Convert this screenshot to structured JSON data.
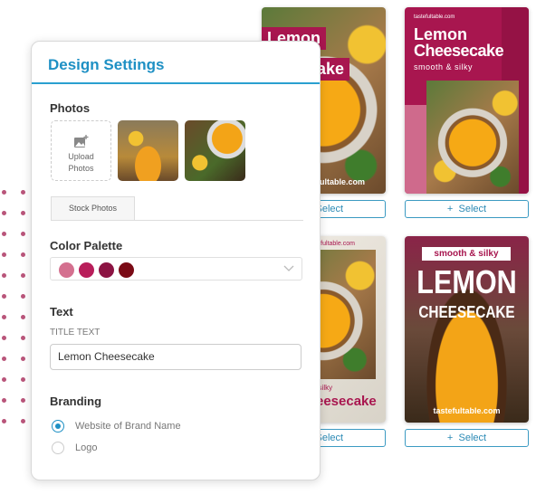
{
  "panel": {
    "title": "Design Settings",
    "photos": {
      "heading": "Photos",
      "upload_label_1": "Upload",
      "upload_label_2": "Photos",
      "tab": "Stock Photos"
    },
    "palette": {
      "heading": "Color Palette",
      "colors": [
        "#d4708f",
        "#b81e5a",
        "#8c1443",
        "#7a0a15"
      ]
    },
    "text": {
      "heading": "Text",
      "field_label": "TITLE TEXT",
      "title_value": "Lemon Cheesecake"
    },
    "branding": {
      "heading": "Branding",
      "options": [
        {
          "label": "Website of Brand Name",
          "selected": true
        },
        {
          "label": "Logo",
          "selected": false
        }
      ]
    }
  },
  "templates": [
    {
      "line1": "Lemon",
      "line2": "cake",
      "site": "tastefultable.com"
    },
    {
      "site": "tastefultable.com",
      "line1": "Lemon",
      "line2": "Cheesecake",
      "tagline": "smooth & silky"
    },
    {
      "site": "tastefultable.com",
      "tagline": "& silky",
      "line2": "Cheesecake"
    },
    {
      "tagline": "smooth & silky",
      "line1": "LEMON",
      "line2": "CHEESECAKE",
      "site": "tastefultable.com"
    }
  ],
  "select_label": "Select",
  "plus": "+",
  "brand_color": "#a8164f",
  "accent": "#1e90c4"
}
